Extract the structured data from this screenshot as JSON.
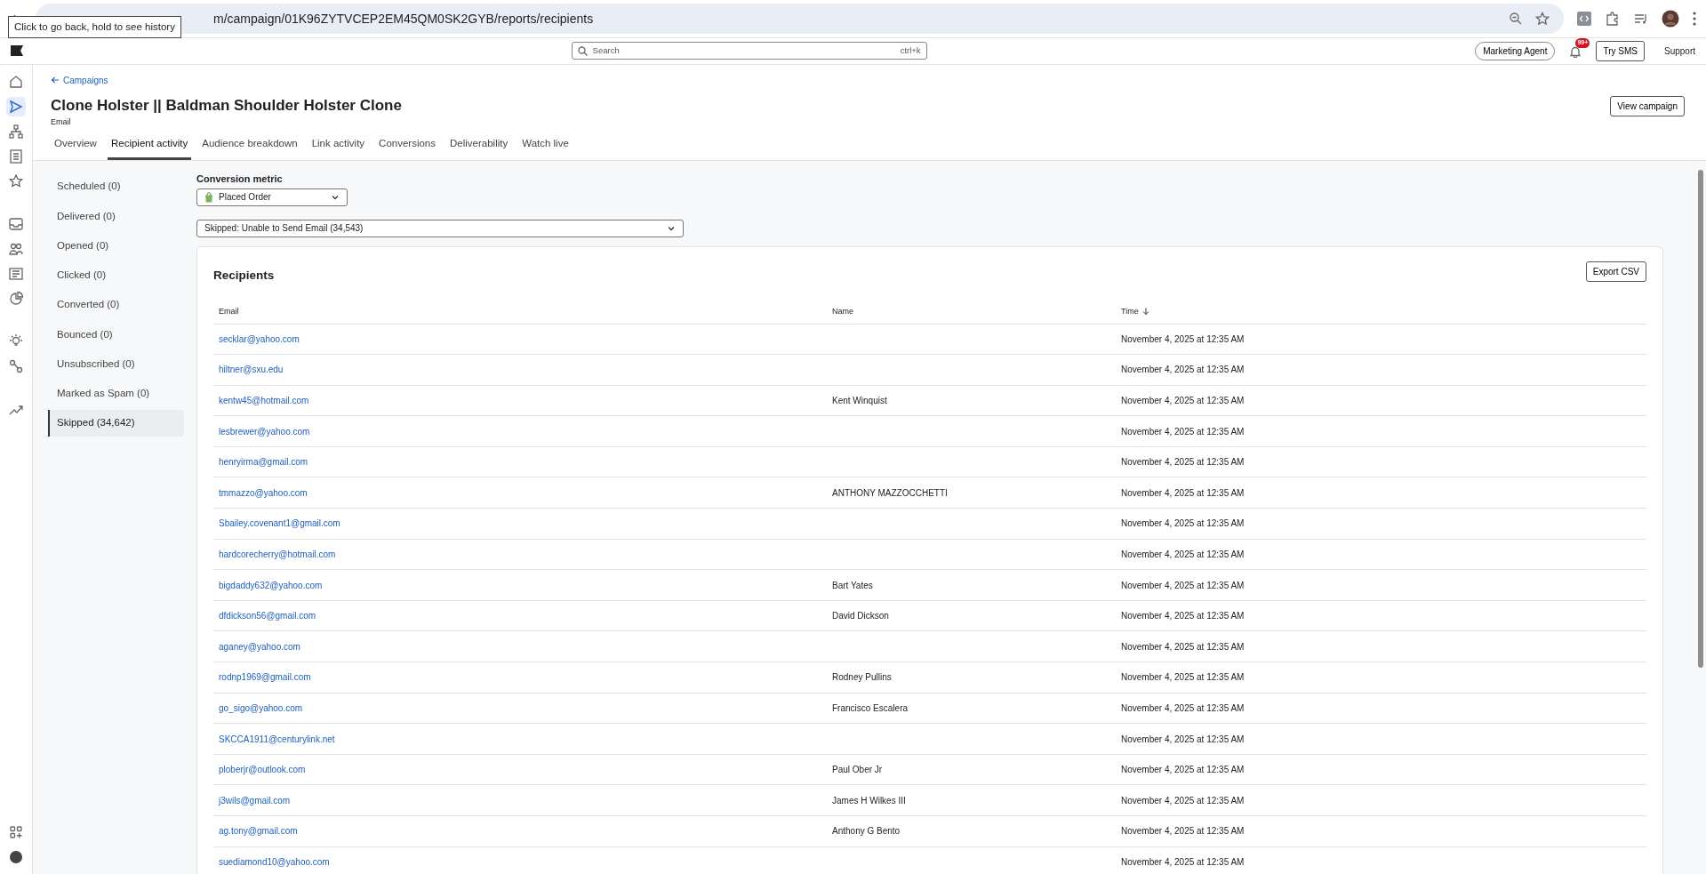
{
  "browser": {
    "url": "m/campaign/01K96ZYTVCEP2EM45QM0SK2GYB/reports/recipients",
    "tooltip": "Click to go back, hold to see history"
  },
  "app_header": {
    "search_placeholder": "Search",
    "shortcut": "ctrl+k",
    "agent_button": "Marketing Agent",
    "notification_count": "99+",
    "sms_button": "Try SMS",
    "support_link": "Support"
  },
  "page": {
    "back_link": "Campaigns",
    "title": "Clone Holster || Baldman Shoulder Holster Clone",
    "subtitle": "Email",
    "view_button": "View campaign"
  },
  "tabs": [
    {
      "label": "Overview",
      "selected": false
    },
    {
      "label": "Recipient activity",
      "selected": true
    },
    {
      "label": "Audience breakdown",
      "selected": false
    },
    {
      "label": "Link activity",
      "selected": false
    },
    {
      "label": "Conversions",
      "selected": false
    },
    {
      "label": "Deliverability",
      "selected": false
    },
    {
      "label": "Watch live",
      "selected": false
    }
  ],
  "sidebar": {
    "items": [
      {
        "label": "Scheduled (0)",
        "selected": false
      },
      {
        "label": "Delivered (0)",
        "selected": false
      },
      {
        "label": "Opened (0)",
        "selected": false
      },
      {
        "label": "Clicked (0)",
        "selected": false
      },
      {
        "label": "Converted (0)",
        "selected": false
      },
      {
        "label": "Bounced (0)",
        "selected": false
      },
      {
        "label": "Unsubscribed (0)",
        "selected": false
      },
      {
        "label": "Marked as Spam (0)",
        "selected": false
      },
      {
        "label": "Skipped (34,642)",
        "selected": true
      }
    ]
  },
  "conversion_metric": {
    "label": "Conversion metric",
    "value": "Placed Order"
  },
  "filter": {
    "value": "Skipped: Unable to Send Email (34,543)"
  },
  "recipients": {
    "title": "Recipients",
    "export_button": "Export CSV",
    "columns": [
      {
        "label": "Email",
        "sorted": false
      },
      {
        "label": "Name",
        "sorted": false
      },
      {
        "label": "Time",
        "sorted": true
      }
    ],
    "rows": [
      {
        "email": "secklar@yahoo.com",
        "name": "",
        "time": "November 4, 2025 at 12:35 AM"
      },
      {
        "email": "hiltner@sxu.edu",
        "name": "",
        "time": "November 4, 2025 at 12:35 AM"
      },
      {
        "email": "kentw45@hotmail.com",
        "name": "Kent Winquist",
        "time": "November 4, 2025 at 12:35 AM"
      },
      {
        "email": "lesbrewer@yahoo.com",
        "name": "",
        "time": "November 4, 2025 at 12:35 AM"
      },
      {
        "email": "henryirma@gmail.com",
        "name": "",
        "time": "November 4, 2025 at 12:35 AM"
      },
      {
        "email": "tmmazzo@yahoo.com",
        "name": "ANTHONY MAZZOCCHETTI",
        "time": "November 4, 2025 at 12:35 AM"
      },
      {
        "email": "Sbailey.covenant1@gmail.com",
        "name": "",
        "time": "November 4, 2025 at 12:35 AM"
      },
      {
        "email": "hardcorecherry@hotmail.com",
        "name": "",
        "time": "November 4, 2025 at 12:35 AM"
      },
      {
        "email": "bigdaddy632@yahoo.com",
        "name": "Bart Yates",
        "time": "November 4, 2025 at 12:35 AM"
      },
      {
        "email": "dfdickson56@gmail.com",
        "name": "David Dickson",
        "time": "November 4, 2025 at 12:35 AM"
      },
      {
        "email": "aganey@yahoo.com",
        "name": "",
        "time": "November 4, 2025 at 12:35 AM"
      },
      {
        "email": "rodnp1969@gmail.com",
        "name": "Rodney Pullins",
        "time": "November 4, 2025 at 12:35 AM"
      },
      {
        "email": "go_sigo@yahoo.com",
        "name": "Francisco Escalera",
        "time": "November 4, 2025 at 12:35 AM"
      },
      {
        "email": "SKCCA1911@centurylink.net",
        "name": "",
        "time": "November 4, 2025 at 12:35 AM"
      },
      {
        "email": "ploberjr@outlook.com",
        "name": "Paul Ober Jr",
        "time": "November 4, 2025 at 12:35 AM"
      },
      {
        "email": "j3wils@gmail.com",
        "name": "James H Wilkes III",
        "time": "November 4, 2025 at 12:35 AM"
      },
      {
        "email": "ag.tony@gmail.com",
        "name": "Anthony G Bento",
        "time": "November 4, 2025 at 12:35 AM"
      },
      {
        "email": "suediamond10@yahoo.com",
        "name": "",
        "time": "November 4, 2025 at 12:35 AM"
      }
    ]
  }
}
